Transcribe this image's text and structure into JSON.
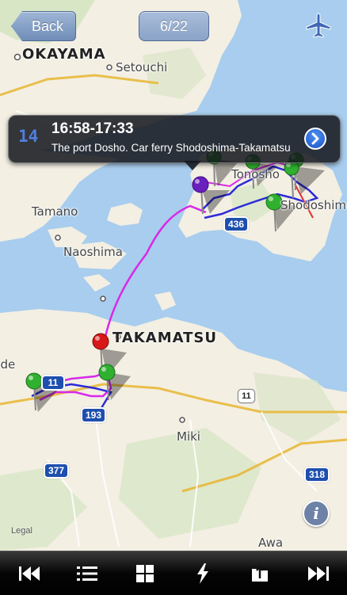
{
  "topbar": {
    "back_label": "Back",
    "page_indicator": "6/22",
    "plane_icon": "airplane-icon"
  },
  "callout": {
    "index": "14",
    "time": "16:58-17:33",
    "description": "The port Dosho. Car ferry Shodoshima-Takamatsu",
    "disclosure_icon": "chevron-right-icon"
  },
  "map": {
    "places": {
      "okayama": "OKAYAMA",
      "setouchi": "Setouchi",
      "tonosho": "Tonosho",
      "shodoshima": "Shodoshima",
      "tamano": "Tamano",
      "naoshima": "Naoshima",
      "takamatsu": "TAKAMATSU",
      "sakaide": "Sakaide",
      "miki": "Miki",
      "awa": "Awa"
    },
    "route_shields": [
      "436",
      "11",
      "11",
      "193",
      "377",
      "318"
    ],
    "legal": "Legal",
    "colors": {
      "sea": "#a8cdee",
      "land": "#f3efe3",
      "route_car": "#2b2bd8",
      "route_ferry": "#d829e8",
      "route_red": "#e03030",
      "pin_green": "#2fb02f",
      "pin_red": "#d81818",
      "pin_purple": "#6a1fbf"
    }
  },
  "info_button": "i",
  "toolbar": [
    "skip-back-icon",
    "list-icon",
    "grid-icon",
    "lightning-icon",
    "export-icon",
    "skip-forward-icon"
  ]
}
